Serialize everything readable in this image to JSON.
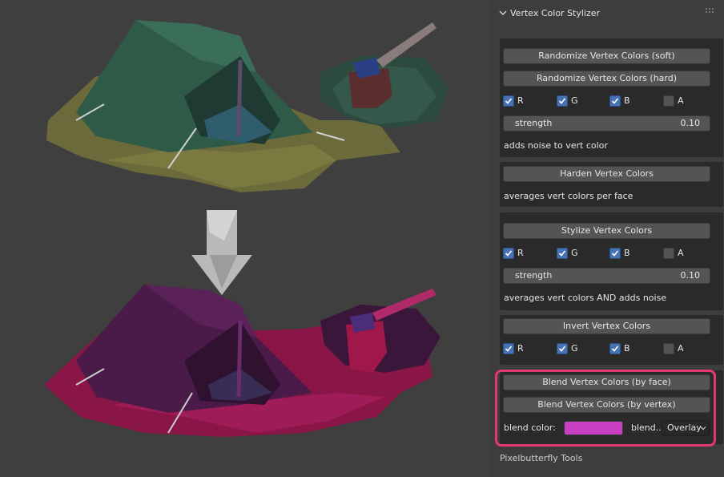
{
  "panel": {
    "title": "Vertex Color Stylizer",
    "footer": "Pixelbutterfly Tools"
  },
  "randomize": {
    "soft_label": "Randomize Vertex Colors (soft)",
    "hard_label": "Randomize Vertex Colors (hard)",
    "channels": [
      {
        "label": "R",
        "checked": true
      },
      {
        "label": "G",
        "checked": true
      },
      {
        "label": "B",
        "checked": true
      },
      {
        "label": "A",
        "checked": false
      }
    ],
    "strength_label": "strength",
    "strength_value": "0.10",
    "desc": "adds noise to vert color"
  },
  "harden": {
    "label": "Harden Vertex Colors",
    "desc": "averages vert colors per face"
  },
  "stylize": {
    "label": "Stylize Vertex Colors",
    "channels": [
      {
        "label": "R",
        "checked": true
      },
      {
        "label": "G",
        "checked": true
      },
      {
        "label": "B",
        "checked": true
      },
      {
        "label": "A",
        "checked": false
      }
    ],
    "strength_label": "strength",
    "strength_value": "0.10",
    "desc": "averages vert colors AND adds noise"
  },
  "invert": {
    "label": "Invert Vertex Colors",
    "channels": [
      {
        "label": "R",
        "checked": true
      },
      {
        "label": "G",
        "checked": true
      },
      {
        "label": "B",
        "checked": true
      },
      {
        "label": "A",
        "checked": false
      }
    ]
  },
  "blend": {
    "by_face_label": "Blend Vertex Colors (by face)",
    "by_vertex_label": "Blend Vertex Colors (by vertex)",
    "color_label": "blend color:",
    "color_value": "#c93fc1",
    "mode_label": "blend...",
    "mode_value": "Overlay"
  },
  "colors": {
    "highlight": "#e8396e",
    "checkbox_on": "#4772b3",
    "button": "#545454"
  }
}
